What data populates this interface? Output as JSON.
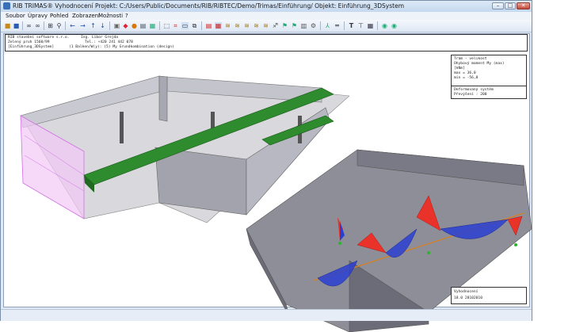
{
  "title": "RIB TRIMAS®  Vyhodnocení  Projekt: C:/Users/Public/Documents/RIB/RIBTEC/Demo/Trimas/Einführung/  Objekt: Einführung_3DSystem",
  "window_buttons": {
    "minimize": "–",
    "restore": "□",
    "close": "✕"
  },
  "menu": [
    "Soubor",
    "Úpravy",
    "Pohled",
    "Zobrazení",
    "Možnosti",
    "?"
  ],
  "toolbar_icons": [
    "open-icon",
    "save-icon",
    "binoculars-icon",
    "binoculars-alt-icon",
    "zoom-fit-icon",
    "zoom-icon",
    "arrow-left-icon",
    "arrow-right-icon",
    "arrow-up-icon",
    "arrow-down-icon",
    "model-icon",
    "layers-icon",
    "color-icon",
    "print-icon",
    "grid-icon",
    "view-icon",
    "mesh-icon",
    "result-icon",
    "section-icon",
    "beam-icon",
    "slab-icon",
    "wall-icon",
    "load-icon",
    "support-icon",
    "node-icon",
    "text-icon",
    "dimension-icon",
    "table-icon",
    "help-icon",
    "ok-icon"
  ],
  "header": {
    "company": "RIB stavební software s.r.o.",
    "engineer": "Ing. Libor Grejda",
    "address": "Zelený pruh 1560/99",
    "phone": "Tel.: +420 241 442 078",
    "system": "[Einführung_3DSystem]",
    "loadcase": "(1 Balken/W(y): (5) My Grundkombination (design)"
  },
  "legend": {
    "lines": [
      "Trám - velikosť",
      "Ohybový moment My (max)",
      "[kNm]",
      "max = 36,0",
      "min = -56,8"
    ],
    "system_lines": [
      "Deformovaný systém",
      "Převýšení : 200"
    ]
  },
  "footer": {
    "line1": "Vyhodnocení",
    "line2": "18.0 28102010"
  },
  "colors": {
    "accent_blue": "#3b6fb6",
    "beam_green": "#2e8b2e",
    "moment_red": "#e8322a",
    "moment_blue": "#2a3fd0",
    "wall_pink": "#e8a0f0"
  }
}
